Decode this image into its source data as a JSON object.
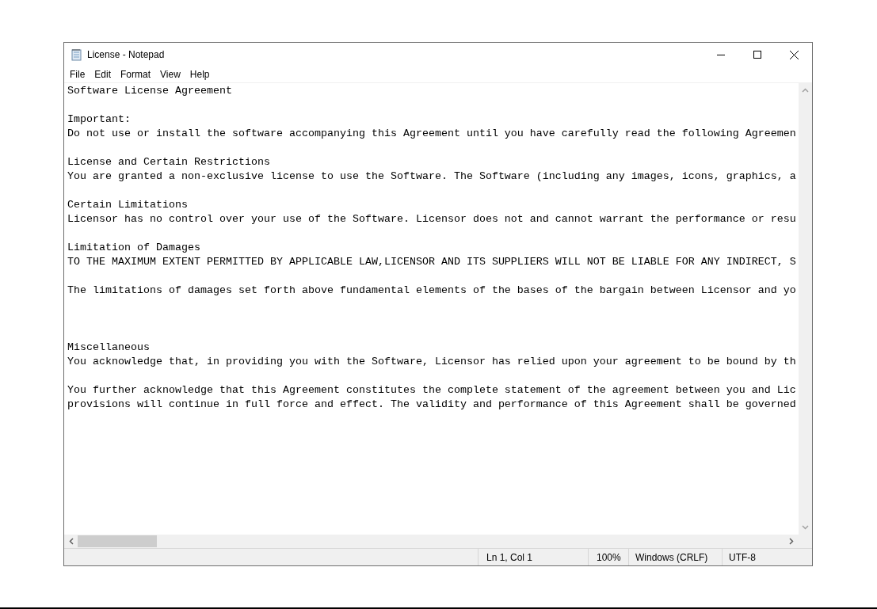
{
  "window": {
    "title": "License - Notepad"
  },
  "menu": [
    "File",
    "Edit",
    "Format",
    "View",
    "Help"
  ],
  "document": {
    "lines": [
      {
        "kind": "text",
        "text": "Software License Agreement"
      },
      {
        "kind": "blank"
      },
      {
        "kind": "text",
        "text": "Important:"
      },
      {
        "kind": "text",
        "text": "Do not use or install the software accompanying this Agreement until you have carefully read the following Agreemen"
      },
      {
        "kind": "blank"
      },
      {
        "kind": "text",
        "text": "License and Certain Restrictions"
      },
      {
        "kind": "text",
        "text": "You are granted a non-exclusive license to use the Software. The Software (including any images, icons, graphics, a"
      },
      {
        "kind": "blank"
      },
      {
        "kind": "text",
        "text": "Certain Limitations"
      },
      {
        "kind": "text",
        "text": "Licensor has no control over your use of the Software. Licensor does not and cannot warrant the performance or resu"
      },
      {
        "kind": "blank"
      },
      {
        "kind": "text",
        "text": "Limitation of Damages"
      },
      {
        "kind": "text",
        "text": "TO THE MAXIMUM EXTENT PERMITTED BY APPLICABLE LAW,LICENSOR AND ITS SUPPLIERS WILL NOT BE LIABLE FOR ANY INDIRECT, S"
      },
      {
        "kind": "blank"
      },
      {
        "kind": "text",
        "text": "The limitations of damages set forth above fundamental elements of the bases of the bargain between Licensor and yo"
      },
      {
        "kind": "blank"
      },
      {
        "kind": "blank"
      },
      {
        "kind": "blank"
      },
      {
        "kind": "text",
        "text": "Miscellaneous"
      },
      {
        "kind": "text",
        "text": "You acknowledge that, in providing you with the Software, Licensor has relied upon your agreement to be bound by th"
      },
      {
        "kind": "blank"
      },
      {
        "kind": "text",
        "text": "You further acknowledge that this Agreement constitutes the complete statement of the agreement between you and Lic"
      },
      {
        "kind": "text",
        "text": "provisions will continue in full force and effect. The validity and performance of this Agreement shall be governed"
      }
    ]
  },
  "status_bar": {
    "position": "Ln 1, Col 1",
    "zoom": "100%",
    "line_endings": "Windows (CRLF)",
    "encoding": "UTF-8"
  }
}
